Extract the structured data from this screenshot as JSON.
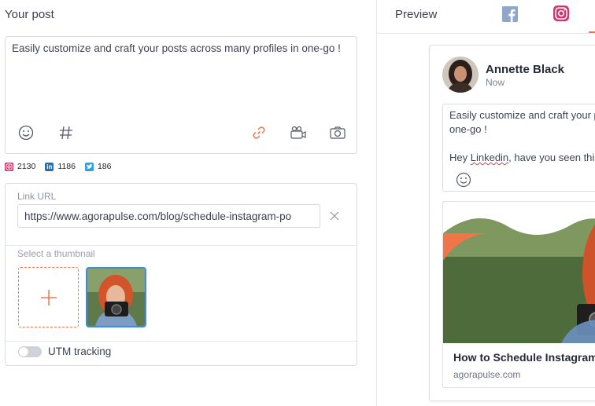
{
  "composer": {
    "section_title": "Your post",
    "text": "Easily customize and craft your posts across many profiles in one-go !",
    "tools": [
      "emoji-icon",
      "hashtag-icon",
      "link-icon",
      "video-icon",
      "camera-icon"
    ]
  },
  "counters": [
    {
      "network": "instagram",
      "count": "2130",
      "color": "#d6336c"
    },
    {
      "network": "linkedin",
      "count": "1186",
      "color": "#1f72b5"
    },
    {
      "network": "twitter",
      "count": "186",
      "color": "#2aa0ee"
    }
  ],
  "link": {
    "label": "Link URL",
    "url": "https://www.agorapulse.com/blog/schedule-instagram-po",
    "thumbnail_label": "Select a thumbnail",
    "utm_label": "UTM tracking",
    "utm_enabled": false
  },
  "preview": {
    "label": "Preview",
    "tabs": [
      "facebook",
      "instagram"
    ],
    "author": "Annette Black",
    "time": "Now",
    "text_line1": "Easily customize and craft your posts",
    "text_line2": "one-go !",
    "text_line3_a": "Hey ",
    "text_line3_b": "Linkedin",
    "text_line3_c": ", have you seen this?",
    "link_title": "How to Schedule Instagram Posts",
    "link_domain": "agorapulse.com"
  },
  "colors": {
    "accent": "#f0764a",
    "selected_border": "#3a8de0",
    "facebook": "#3b5998",
    "instagram": "#d6336c"
  }
}
